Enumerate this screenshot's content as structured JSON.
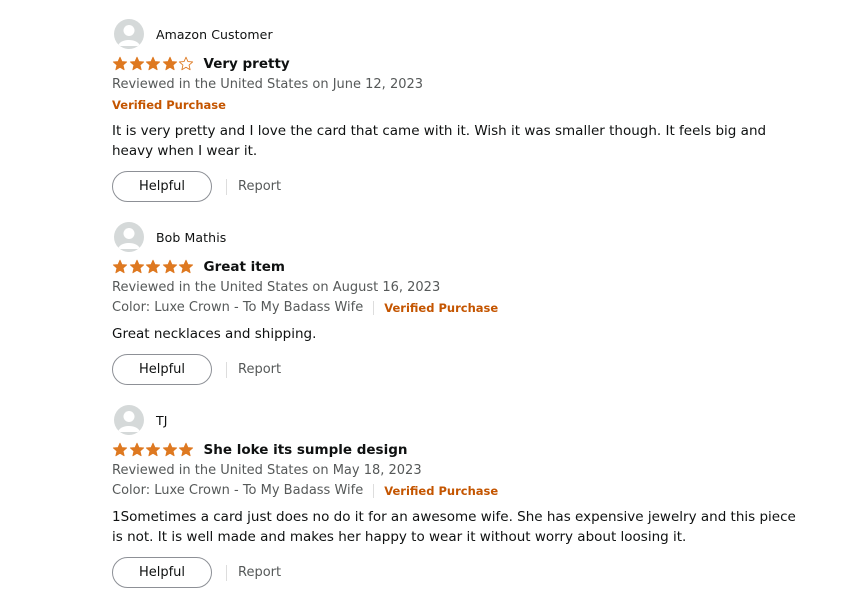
{
  "colors": {
    "star": "#de7921",
    "verified": "#c45500",
    "muted": "#565959",
    "text": "#0f1111",
    "avatar_bg": "#d5d9d9"
  },
  "icons": {
    "avatar": "default-profile-icon",
    "star": "star-icon"
  },
  "reviews": [
    {
      "profile_name": "Amazon Customer",
      "rating": 4,
      "rating_max": 5,
      "title": "Very pretty",
      "reviewed_on": "Reviewed in the United States on June 12, 2023",
      "format": "",
      "verified": "Verified Purchase",
      "body": "It is very pretty and I love the card that came with it. Wish it was smaller though. It feels big and heavy when I wear it.",
      "helpful_label": "Helpful",
      "report_label": "Report"
    },
    {
      "profile_name": "Bob Mathis",
      "rating": 5,
      "rating_max": 5,
      "title": "Great item",
      "reviewed_on": "Reviewed in the United States on August 16, 2023",
      "format": "Color: Luxe Crown - To My Badass Wife",
      "verified": "Verified Purchase",
      "body": "Great necklaces and shipping.",
      "helpful_label": "Helpful",
      "report_label": "Report"
    },
    {
      "profile_name": "TJ",
      "rating": 5,
      "rating_max": 5,
      "title": "She loke its sumple design",
      "reviewed_on": "Reviewed in the United States on May 18, 2023",
      "format": "Color: Luxe Crown - To My Badass Wife",
      "verified": "Verified Purchase",
      "body": "1Sometimes a card just does no do it for an awesome wife. She has expensive jewelry and this piece is not. It is well made and makes her happy to wear it without worry about loosing it.",
      "helpful_label": "Helpful",
      "report_label": "Report"
    }
  ]
}
